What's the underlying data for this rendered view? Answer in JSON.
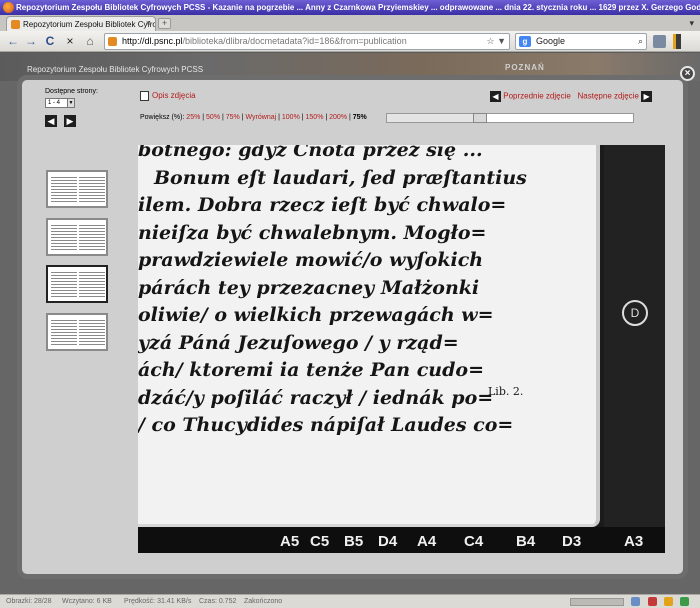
{
  "browser": {
    "window_title": "Repozytorium Zespołu Bibliotek Cyfrowych PCSS - Kazanie na pogrzebie ... Anny z Czarnkowa Przyiemskiey ... odprawowane ... dnia 22. stycznia roku ... 1629 przez X. Gerzego Godziszeviusa... - Mo...",
    "tab_label": "Repozytorium Zespołu Bibliotek Cyfrowy...",
    "tab_close": "×",
    "new_tab": "+",
    "nav": {
      "back": "←",
      "forward": "→",
      "reload": "C",
      "stop": "×",
      "home": "⌂"
    },
    "url_domain": "http://dl.psnc.pl",
    "url_path": "/biblioteka/dlibra/docmetadata?id=186&from=publication",
    "url_right": "☆ ▼",
    "search_engine": "Google",
    "search_engine_glyph": "g",
    "search_icon_glyph": "⌕"
  },
  "page": {
    "site_name": "Repozytorium Zespołu Bibliotek Cyfrowych PCSS",
    "header_banner": "POZNAŃ",
    "close_glyph": "×"
  },
  "viewer_controls": {
    "pages_label": "Dostępne strony:",
    "pages_value": "1 - 4",
    "select_arrow": "▼",
    "prev_arrow": "◀",
    "next_arrow": "▶",
    "description_link": "Opis zdjęcia",
    "prev_image": "Poprzednie zdjęcie",
    "next_image": "Następne zdjęcie",
    "zoom_label": "Powiększ (%):",
    "zoom_levels": [
      "25%",
      "50%",
      "75%",
      "Wyrównaj",
      "100%",
      "150%",
      "200%"
    ],
    "zoom_current": "75%",
    "zoom_fraction": 0.38
  },
  "thumbnails": [
    {
      "active": false
    },
    {
      "active": false
    },
    {
      "active": true
    },
    {
      "active": false
    }
  ],
  "scan_text": {
    "lines": [
      "botnego: gdyż Cnotá przez się ...",
      "Bonum eſt laudari, ſed præſtantius",
      "ilem. Dobra rzecz ieſt być chwalo=",
      "nieiſza być chwalebnym. Mogło=",
      "prawdziewiele mowić/o wyſokich",
      "párách tey przezacney Małżonki",
      "oliwie/ o wielkich przewagách w=",
      "yzá Páná Jezuſowego / y rząd=",
      "ách/ ktoremi ia tenże Pan cudo=",
      "dzáć/y poſiláć raczył / iednák po=",
      "/ co Thucydides nápiſał Laudes co="
    ],
    "margin_note": "Lib. 2.",
    "dark_mark": "D"
  },
  "signatures": [
    "A5",
    "C5",
    "B5",
    "D4",
    "A4",
    "C4",
    "B4",
    "D3",
    "A3"
  ],
  "status": {
    "images": "Obrazki: 28/28",
    "loaded": "Wczytano: 6 KB",
    "speed": "Prędkość: 31.41 KB/s",
    "time": "Czas: 0.752",
    "done": "Zakończono"
  }
}
